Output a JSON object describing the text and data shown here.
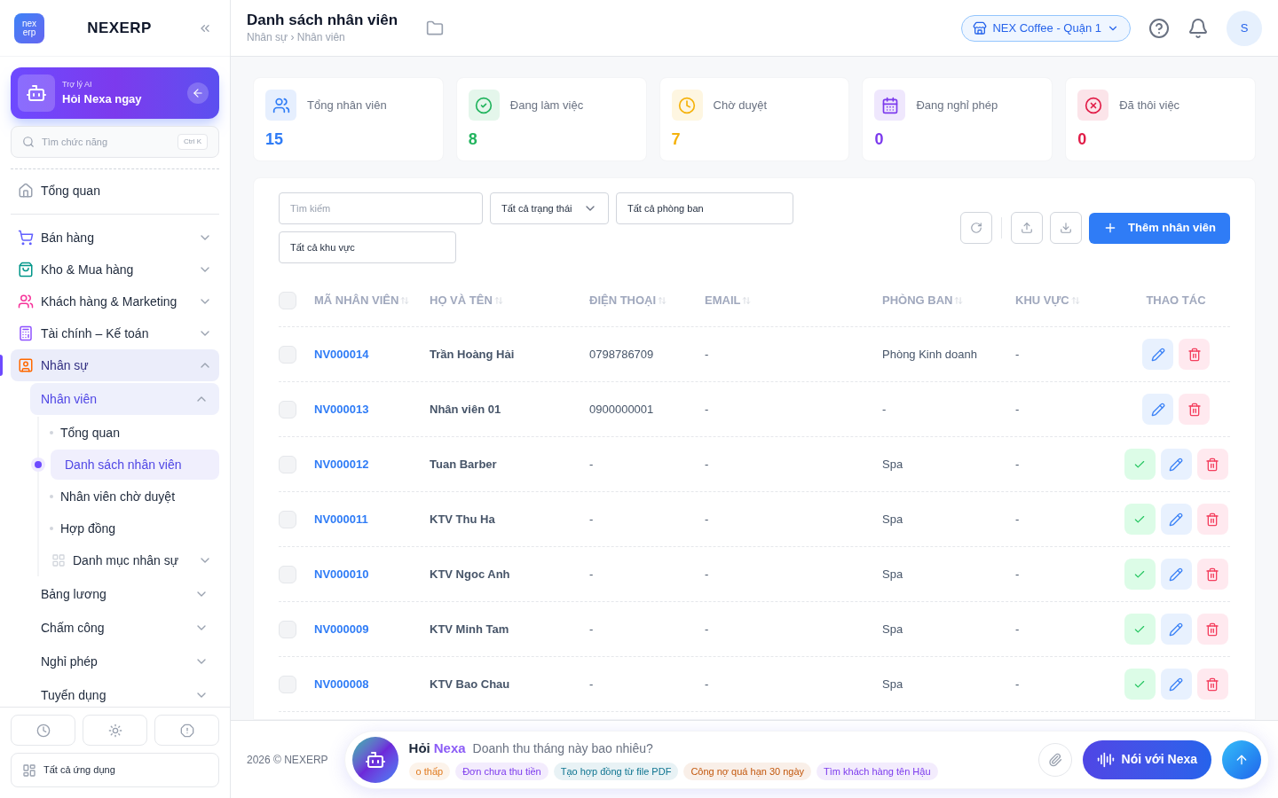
{
  "sidebar": {
    "logo_lines": [
      "nex",
      "erp"
    ],
    "brand": "NEXERP",
    "ai_card": {
      "caption": "Trợ lý AI",
      "title": "Hỏi Nexa ngay"
    },
    "search": {
      "placeholder": "Tìm chức năng",
      "shortcut": "Ctrl K"
    },
    "nav": [
      {
        "label": "Tổng quan",
        "selected": false
      },
      {
        "label": "Bán hàng",
        "selected": false,
        "expanded": false
      },
      {
        "label": "Kho & Mua hàng",
        "selected": false,
        "expanded": false
      },
      {
        "label": "Khách hàng & Marketing",
        "selected": false,
        "expanded": false
      },
      {
        "label": "Tài chính – Kế toán",
        "selected": false,
        "expanded": false
      },
      {
        "label": "Nhân sự",
        "selected": true,
        "expanded": true,
        "children": [
          {
            "label": "Nhân viên",
            "selected": true,
            "expanded": true,
            "children": [
              {
                "kind": "leaf",
                "label": "Tổng quan",
                "selected": false
              },
              {
                "kind": "leaf",
                "label": "Danh sách nhân viên",
                "selected": true
              },
              {
                "kind": "leaf",
                "label": "Nhân viên chờ duyệt",
                "selected": false
              },
              {
                "kind": "leaf",
                "label": "Hợp đồng",
                "selected": false
              },
              {
                "kind": "group",
                "label": "Danh mục nhân sự",
                "selected": false,
                "expanded": false
              }
            ]
          },
          {
            "label": "Bảng lương",
            "selected": false,
            "expanded": false
          },
          {
            "label": "Chấm công",
            "selected": false,
            "expanded": false
          },
          {
            "label": "Nghỉ phép",
            "selected": false,
            "expanded": false
          },
          {
            "label": "Tuyển dụng",
            "selected": false,
            "expanded": false
          }
        ]
      }
    ],
    "apps_label": "Tất cả ứng dụng"
  },
  "header": {
    "title": "Danh sách nhân viên",
    "breadcrumb": "Nhân sự › Nhân viên",
    "store": "NEX Coffee - Quận 1",
    "avatar": "S"
  },
  "stats": [
    {
      "kind": "total",
      "label": "Tổng nhân viên",
      "value": "15",
      "color": "#2f7cf6"
    },
    {
      "kind": "active",
      "label": "Đang làm việc",
      "value": "8",
      "color": "#22b45e"
    },
    {
      "kind": "pending",
      "label": "Chờ duyệt",
      "value": "7",
      "color": "#f5b20b"
    },
    {
      "kind": "leave",
      "label": "Đang nghỉ phép",
      "value": "0",
      "color": "#7c3aed"
    },
    {
      "kind": "quit",
      "label": "Đã thôi việc",
      "value": "0",
      "color": "#e11d48"
    }
  ],
  "filters": {
    "search": {
      "placeholder": "Tìm kiếm"
    },
    "status": "Tất cả trạng thái",
    "department": "Tất cả phòng ban",
    "region": "Tất cả khu vực"
  },
  "add_button": "Thêm nhân viên",
  "table": {
    "select_all_checked": false,
    "columns": [
      {
        "label": "MÃ NHÂN VIÊN",
        "sortable": true
      },
      {
        "label": "HỌ VÀ TÊN",
        "sortable": true
      },
      {
        "label": "ĐIỆN THOẠI",
        "sortable": true
      },
      {
        "label": "EMAIL",
        "sortable": true
      },
      {
        "label": "PHÒNG BAN",
        "sortable": true
      },
      {
        "label": "KHU VỰC",
        "sortable": true
      },
      {
        "label": "THAO TÁC",
        "sortable": false
      }
    ],
    "rows": [
      {
        "checked": false,
        "code": "NV000014",
        "name": "Trần Hoàng Hải",
        "phone": "0798786709",
        "email": "-",
        "department": "Phòng Kinh doanh",
        "region": "-",
        "approvable": false
      },
      {
        "checked": false,
        "code": "NV000013",
        "name": "Nhân viên 01",
        "phone": "0900000001",
        "email": "-",
        "department": "-",
        "region": "-",
        "approvable": false
      },
      {
        "checked": false,
        "code": "NV000012",
        "name": "Tuan Barber",
        "phone": "-",
        "email": "-",
        "department": "Spa",
        "region": "-",
        "approvable": true
      },
      {
        "checked": false,
        "code": "NV000011",
        "name": "KTV Thu Ha",
        "phone": "-",
        "email": "-",
        "department": "Spa",
        "region": "-",
        "approvable": true
      },
      {
        "checked": false,
        "code": "NV000010",
        "name": "KTV Ngoc Anh",
        "phone": "-",
        "email": "-",
        "department": "Spa",
        "region": "-",
        "approvable": true
      },
      {
        "checked": false,
        "code": "NV000009",
        "name": "KTV Minh Tam",
        "phone": "-",
        "email": "-",
        "department": "Spa",
        "region": "-",
        "approvable": true
      },
      {
        "checked": false,
        "code": "NV000008",
        "name": "KTV Bao Chau",
        "phone": "-",
        "email": "-",
        "department": "Spa",
        "region": "-",
        "approvable": true
      }
    ]
  },
  "footer": {
    "copyright": "2026 © NEXERP",
    "nexa": {
      "prefix": "Hỏi",
      "name": "Nexa",
      "placeholder": "Doanh thu tháng này bao nhiêu?",
      "voice_button": "Nói với Nexa",
      "chips": [
        {
          "label": "o thấp",
          "color": "#e07b1f"
        },
        {
          "label": "Đơn chưa thu tiền",
          "color": "#7c3aed"
        },
        {
          "label": "Tạo hợp đồng từ file PDF",
          "color": "#0e7490"
        },
        {
          "label": "Công nợ quá hạn 30 ngày",
          "color": "#c2570c"
        },
        {
          "label": "Tìm khách hàng tên Hậu",
          "color": "#7c3aed"
        }
      ]
    }
  }
}
